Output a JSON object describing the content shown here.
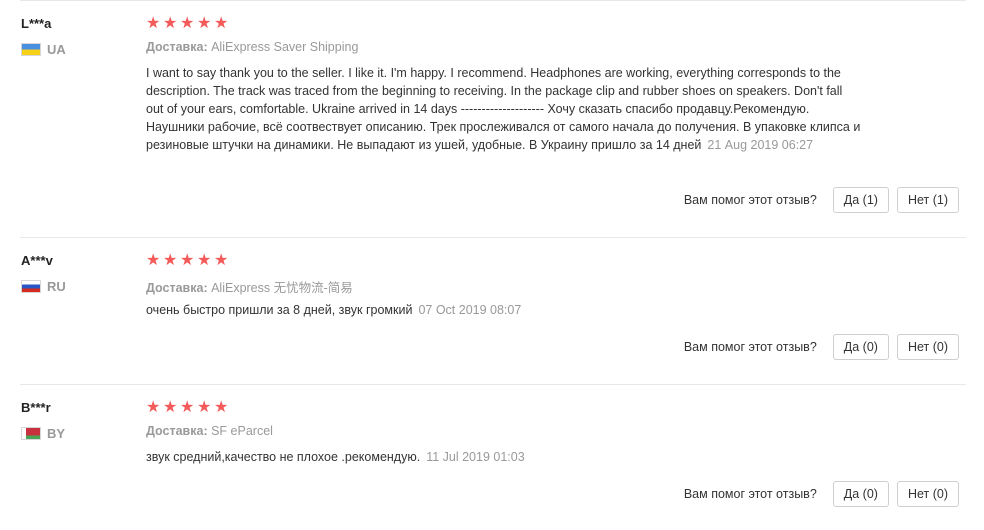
{
  "reviews": [
    {
      "user": "L***a",
      "country": "UA",
      "rating": 5,
      "delivery_label": "Доставка:",
      "delivery_value": "AliExpress Saver Shipping",
      "text": "I want to say thank you to the seller. I like it. I'm happy. I recommend. Headphones are working, everything corresponds to the description. The track was traced from the beginning to receiving. In the package clip and rubber shoes on speakers. Don't fall out of your ears, comfortable. Ukraine arrived in 14 days -------------------- Хочу сказать спасибо продавцу.Рекомендую. Наушники рабочие, всё соотвествует описанию. Трек прослеживался от самого начала до получения. В упаковке клипса и резиновые штучки на динамики. Не выпадают из ушей, удобные. В Украину пришло за 14 дней",
      "date": "21 Aug 2019 06:27",
      "helpful_question": "Вам помог этот отзыв?",
      "yes_label": "Да (1)",
      "no_label": "Нет (1)"
    },
    {
      "user": "A***v",
      "country": "RU",
      "rating": 5,
      "delivery_label": "Доставка:",
      "delivery_value": "AliExpress 无忧物流-简易",
      "text": "очень быстро пришли за 8 дней, звук громкий",
      "date": "07 Oct 2019 08:07",
      "helpful_question": "Вам помог этот отзыв?",
      "yes_label": "Да (0)",
      "no_label": "Нет (0)"
    },
    {
      "user": "B***r",
      "country": "BY",
      "rating": 5,
      "delivery_label": "Доставка:",
      "delivery_value": "SF eParcel",
      "text": "звук средний,качество не плохое .рекомендую.",
      "date": "11 Jul 2019 01:03",
      "helpful_question": "Вам помог этот отзыв?",
      "yes_label": "Да (0)",
      "no_label": "Нет (0)"
    }
  ],
  "star_glyph": "★",
  "star_color": "#f55a5a"
}
